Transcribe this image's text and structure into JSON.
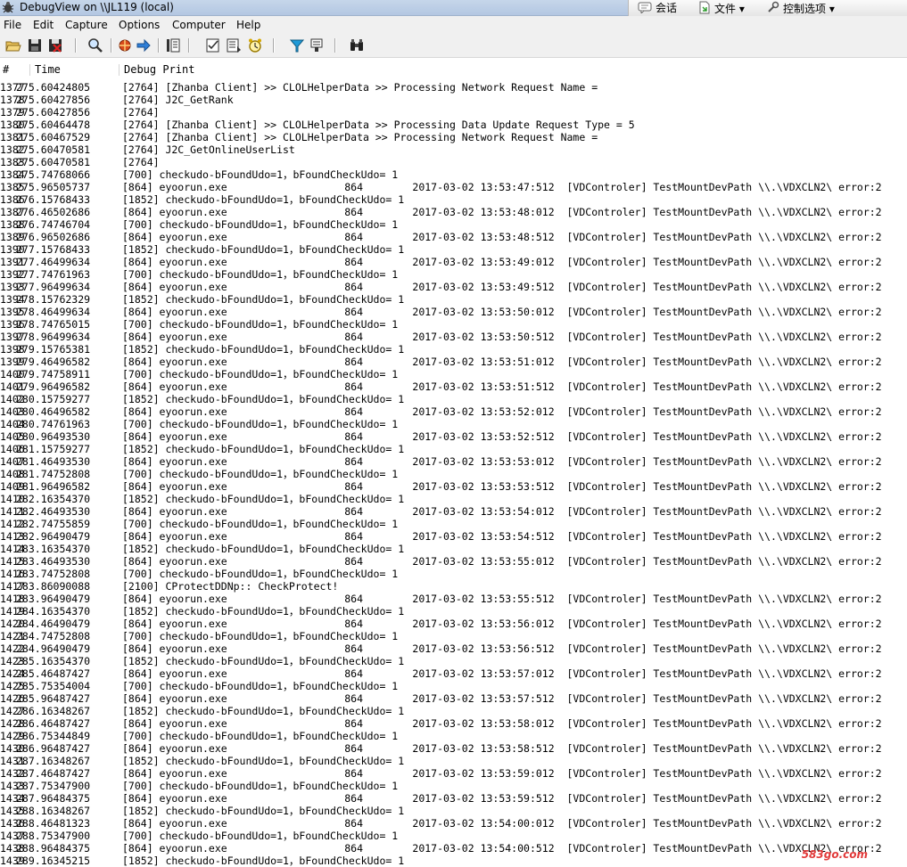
{
  "window": {
    "title": "DebugView on \\\\JL119 (local)"
  },
  "qq_bar": {
    "items": [
      {
        "name": "chat",
        "label": "会话",
        "icon": "chat-icon"
      },
      {
        "name": "file",
        "label": "文件 ▾",
        "icon": "file-icon"
      },
      {
        "name": "control",
        "label": "控制选项 ▾",
        "icon": "control-icon"
      }
    ]
  },
  "menu": {
    "items": [
      {
        "name": "file",
        "label": "File"
      },
      {
        "name": "edit",
        "label": "Edit"
      },
      {
        "name": "capture",
        "label": "Capture"
      },
      {
        "name": "options",
        "label": "Options"
      },
      {
        "name": "computer",
        "label": "Computer"
      },
      {
        "name": "help",
        "label": "Help"
      }
    ]
  },
  "toolbar": {
    "icons": [
      "open-icon",
      "save-icon",
      "clear-icon",
      "find-icon",
      "capture-icon",
      "forward-icon",
      "autoscroll-icon",
      "clock-icon",
      "time-icon",
      "filter-icon",
      "highlight-icon",
      "history-icon",
      "binoculars-icon"
    ]
  },
  "columns": {
    "num": "#",
    "time": "Time",
    "message": "Debug Print"
  },
  "watermark": "583go.com",
  "rows": [
    [
      "1377",
      "275.60424805",
      "[2764] [Zhanba Client] >> CLOLHelperData >> Processing Network Request Name ="
    ],
    [
      "1378",
      "275.60427856",
      "[2764] J2C_GetRank"
    ],
    [
      "1379",
      "275.60427856",
      "[2764]"
    ],
    [
      "1380",
      "275.60464478",
      "[2764] [Zhanba Client] >> CLOLHelperData >> Processing Data Update Request Type = 5"
    ],
    [
      "1381",
      "275.60467529",
      "[2764] [Zhanba Client] >> CLOLHelperData >> Processing Network Request Name ="
    ],
    [
      "1382",
      "275.60470581",
      "[2764] J2C_GetOnlineUserList"
    ],
    [
      "1383",
      "275.60470581",
      "[2764]"
    ],
    [
      "1384",
      "275.74768066",
      "[700] checkudo-bFoundUdo=1，bFoundCheckUdo= 1"
    ],
    [
      "1385",
      "275.96505737",
      "[864] eyoorun.exe                   864        2017-03-02 13:53:47:512  [VDControler] TestMountDevPath \\\\.\\VDXCLN2\\ error:2"
    ],
    [
      "1386",
      "276.15768433",
      "[1852] checkudo-bFoundUdo=1，bFoundCheckUdo= 1"
    ],
    [
      "1387",
      "276.46502686",
      "[864] eyoorun.exe                   864        2017-03-02 13:53:48:012  [VDControler] TestMountDevPath \\\\.\\VDXCLN2\\ error:2"
    ],
    [
      "1388",
      "276.74746704",
      "[700] checkudo-bFoundUdo=1，bFoundCheckUdo= 1"
    ],
    [
      "1389",
      "276.96502686",
      "[864] eyoorun.exe                   864        2017-03-02 13:53:48:512  [VDControler] TestMountDevPath \\\\.\\VDXCLN2\\ error:2"
    ],
    [
      "1390",
      "277.15768433",
      "[1852] checkudo-bFoundUdo=1，bFoundCheckUdo= 1"
    ],
    [
      "1391",
      "277.46499634",
      "[864] eyoorun.exe                   864        2017-03-02 13:53:49:012  [VDControler] TestMountDevPath \\\\.\\VDXCLN2\\ error:2"
    ],
    [
      "1392",
      "277.74761963",
      "[700] checkudo-bFoundUdo=1，bFoundCheckUdo= 1"
    ],
    [
      "1393",
      "277.96499634",
      "[864] eyoorun.exe                   864        2017-03-02 13:53:49:512  [VDControler] TestMountDevPath \\\\.\\VDXCLN2\\ error:2"
    ],
    [
      "1394",
      "278.15762329",
      "[1852] checkudo-bFoundUdo=1，bFoundCheckUdo= 1"
    ],
    [
      "1395",
      "278.46499634",
      "[864] eyoorun.exe                   864        2017-03-02 13:53:50:012  [VDControler] TestMountDevPath \\\\.\\VDXCLN2\\ error:2"
    ],
    [
      "1396",
      "278.74765015",
      "[700] checkudo-bFoundUdo=1，bFoundCheckUdo= 1"
    ],
    [
      "1397",
      "278.96499634",
      "[864] eyoorun.exe                   864        2017-03-02 13:53:50:512  [VDControler] TestMountDevPath \\\\.\\VDXCLN2\\ error:2"
    ],
    [
      "1398",
      "279.15765381",
      "[1852] checkudo-bFoundUdo=1，bFoundCheckUdo= 1"
    ],
    [
      "1399",
      "279.46496582",
      "[864] eyoorun.exe                   864        2017-03-02 13:53:51:012  [VDControler] TestMountDevPath \\\\.\\VDXCLN2\\ error:2"
    ],
    [
      "1400",
      "279.74758911",
      "[700] checkudo-bFoundUdo=1，bFoundCheckUdo= 1"
    ],
    [
      "1401",
      "279.96496582",
      "[864] eyoorun.exe                   864        2017-03-02 13:53:51:512  [VDControler] TestMountDevPath \\\\.\\VDXCLN2\\ error:2"
    ],
    [
      "1402",
      "280.15759277",
      "[1852] checkudo-bFoundUdo=1，bFoundCheckUdo= 1"
    ],
    [
      "1403",
      "280.46496582",
      "[864] eyoorun.exe                   864        2017-03-02 13:53:52:012  [VDControler] TestMountDevPath \\\\.\\VDXCLN2\\ error:2"
    ],
    [
      "1404",
      "280.74761963",
      "[700] checkudo-bFoundUdo=1，bFoundCheckUdo= 1"
    ],
    [
      "1405",
      "280.96493530",
      "[864] eyoorun.exe                   864        2017-03-02 13:53:52:512  [VDControler] TestMountDevPath \\\\.\\VDXCLN2\\ error:2"
    ],
    [
      "1406",
      "281.15759277",
      "[1852] checkudo-bFoundUdo=1，bFoundCheckUdo= 1"
    ],
    [
      "1407",
      "281.46493530",
      "[864] eyoorun.exe                   864        2017-03-02 13:53:53:012  [VDControler] TestMountDevPath \\\\.\\VDXCLN2\\ error:2"
    ],
    [
      "1408",
      "281.74752808",
      "[700] checkudo-bFoundUdo=1，bFoundCheckUdo= 1"
    ],
    [
      "1409",
      "281.96496582",
      "[864] eyoorun.exe                   864        2017-03-02 13:53:53:512  [VDControler] TestMountDevPath \\\\.\\VDXCLN2\\ error:2"
    ],
    [
      "1410",
      "282.16354370",
      "[1852] checkudo-bFoundUdo=1，bFoundCheckUdo= 1"
    ],
    [
      "1411",
      "282.46493530",
      "[864] eyoorun.exe                   864        2017-03-02 13:53:54:012  [VDControler] TestMountDevPath \\\\.\\VDXCLN2\\ error:2"
    ],
    [
      "1412",
      "282.74755859",
      "[700] checkudo-bFoundUdo=1，bFoundCheckUdo= 1"
    ],
    [
      "1413",
      "282.96490479",
      "[864] eyoorun.exe                   864        2017-03-02 13:53:54:512  [VDControler] TestMountDevPath \\\\.\\VDXCLN2\\ error:2"
    ],
    [
      "1414",
      "283.16354370",
      "[1852] checkudo-bFoundUdo=1，bFoundCheckUdo= 1"
    ],
    [
      "1415",
      "283.46493530",
      "[864] eyoorun.exe                   864        2017-03-02 13:53:55:012  [VDControler] TestMountDevPath \\\\.\\VDXCLN2\\ error:2"
    ],
    [
      "1416",
      "283.74752808",
      "[700] checkudo-bFoundUdo=1，bFoundCheckUdo= 1"
    ],
    [
      "1417",
      "283.86090088",
      "[2100] CProtectDDNp:: CheckProtect!"
    ],
    [
      "1418",
      "283.96490479",
      "[864] eyoorun.exe                   864        2017-03-02 13:53:55:512  [VDControler] TestMountDevPath \\\\.\\VDXCLN2\\ error:2"
    ],
    [
      "1419",
      "284.16354370",
      "[1852] checkudo-bFoundUdo=1，bFoundCheckUdo= 1"
    ],
    [
      "1420",
      "284.46490479",
      "[864] eyoorun.exe                   864        2017-03-02 13:53:56:012  [VDControler] TestMountDevPath \\\\.\\VDXCLN2\\ error:2"
    ],
    [
      "1421",
      "284.74752808",
      "[700] checkudo-bFoundUdo=1，bFoundCheckUdo= 1"
    ],
    [
      "1422",
      "284.96490479",
      "[864] eyoorun.exe                   864        2017-03-02 13:53:56:512  [VDControler] TestMountDevPath \\\\.\\VDXCLN2\\ error:2"
    ],
    [
      "1423",
      "285.16354370",
      "[1852] checkudo-bFoundUdo=1，bFoundCheckUdo= 1"
    ],
    [
      "1424",
      "285.46487427",
      "[864] eyoorun.exe                   864        2017-03-02 13:53:57:012  [VDControler] TestMountDevPath \\\\.\\VDXCLN2\\ error:2"
    ],
    [
      "1425",
      "285.75354004",
      "[700] checkudo-bFoundUdo=1，bFoundCheckUdo= 1"
    ],
    [
      "1426",
      "285.96487427",
      "[864] eyoorun.exe                   864        2017-03-02 13:53:57:512  [VDControler] TestMountDevPath \\\\.\\VDXCLN2\\ error:2"
    ],
    [
      "1427",
      "286.16348267",
      "[1852] checkudo-bFoundUdo=1，bFoundCheckUdo= 1"
    ],
    [
      "1428",
      "286.46487427",
      "[864] eyoorun.exe                   864        2017-03-02 13:53:58:012  [VDControler] TestMountDevPath \\\\.\\VDXCLN2\\ error:2"
    ],
    [
      "1429",
      "286.75344849",
      "[700] checkudo-bFoundUdo=1，bFoundCheckUdo= 1"
    ],
    [
      "1430",
      "286.96487427",
      "[864] eyoorun.exe                   864        2017-03-02 13:53:58:512  [VDControler] TestMountDevPath \\\\.\\VDXCLN2\\ error:2"
    ],
    [
      "1431",
      "287.16348267",
      "[1852] checkudo-bFoundUdo=1，bFoundCheckUdo= 1"
    ],
    [
      "1432",
      "287.46487427",
      "[864] eyoorun.exe                   864        2017-03-02 13:53:59:012  [VDControler] TestMountDevPath \\\\.\\VDXCLN2\\ error:2"
    ],
    [
      "1433",
      "287.75347900",
      "[700] checkudo-bFoundUdo=1，bFoundCheckUdo= 1"
    ],
    [
      "1434",
      "287.96484375",
      "[864] eyoorun.exe                   864        2017-03-02 13:53:59:512  [VDControler] TestMountDevPath \\\\.\\VDXCLN2\\ error:2"
    ],
    [
      "1435",
      "288.16348267",
      "[1852] checkudo-bFoundUdo=1，bFoundCheckUdo= 1"
    ],
    [
      "1436",
      "288.46481323",
      "[864] eyoorun.exe                   864        2017-03-02 13:54:00:012  [VDControler] TestMountDevPath \\\\.\\VDXCLN2\\ error:2"
    ],
    [
      "1437",
      "288.75347900",
      "[700] checkudo-bFoundUdo=1，bFoundCheckUdo= 1"
    ],
    [
      "1438",
      "288.96484375",
      "[864] eyoorun.exe                   864        2017-03-02 13:54:00:512  [VDControler] TestMountDevPath \\\\.\\VDXCLN2\\ error:2"
    ],
    [
      "1439",
      "289.16345215",
      "[1852] checkudo-bFoundUdo=1，bFoundCheckUdo= 1"
    ]
  ]
}
